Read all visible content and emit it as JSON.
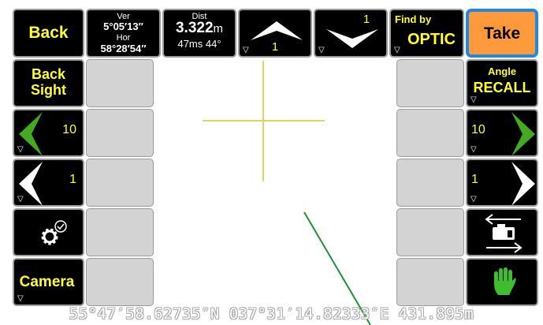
{
  "top": {
    "back_label": "Back",
    "ver_label": "Ver",
    "ver_value": "5°05′13″",
    "hor_label": "Hor",
    "hor_value": "58°28′54″",
    "dist_label": "Dist",
    "dist_value": "3.322",
    "dist_unit": "m",
    "dist_time": "47ms 44°",
    "up_step": "1",
    "down_step": "1",
    "find_by_label": "Find by",
    "find_by_value": "OPTIC",
    "take_label": "Take"
  },
  "left": {
    "back_sight_line1": "Back",
    "back_sight_line2": "Sight",
    "big_step": "10",
    "small_step": "1",
    "camera_label": "Camera"
  },
  "right": {
    "angle_label": "Angle",
    "recall_label": "RECALL",
    "big_step": "10",
    "small_step": "1"
  },
  "footer": {
    "coordinates": "55°47′58.62735″N 037°31′14.82333″E 431.895m"
  },
  "colors": {
    "accent_yellow": "#ffff33",
    "take_orange": "#ff9a3c",
    "take_border": "#1e88e5",
    "arrow_green": "#44aa22",
    "crosshair": "#d8d860",
    "line_green": "#1e8f3a"
  },
  "icons": [
    "settings-check-icon",
    "swap-direction-icon",
    "hand-icon",
    "dropdown-triangle-icon"
  ]
}
